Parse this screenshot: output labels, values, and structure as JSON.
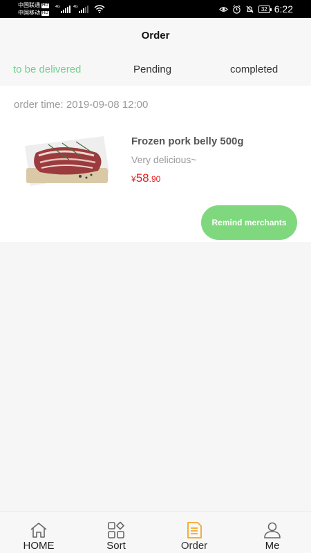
{
  "status_bar": {
    "carrier_1": "中国联通",
    "carrier_2": "中国移动",
    "hd_badge": "HD",
    "network_1": "4G",
    "network_2": "4G",
    "battery_level": "32",
    "time": "6:22"
  },
  "header": {
    "title": "Order"
  },
  "tabs": [
    {
      "label": "to be delivered",
      "active": true
    },
    {
      "label": "Pending",
      "active": false
    },
    {
      "label": "completed",
      "active": false
    }
  ],
  "order": {
    "order_time": "order time: 2019-09-08 12:00",
    "product_name": "Frozen pork belly 500g",
    "product_desc": "Very delicious~",
    "price_symbol": "¥",
    "price_integer": "58",
    "price_decimal": ".90",
    "remind_button": "Remind merchants"
  },
  "nav": [
    {
      "label": "HOME",
      "icon": "home-icon",
      "active": false
    },
    {
      "label": "Sort",
      "icon": "grid-icon",
      "active": false
    },
    {
      "label": "Order",
      "icon": "document-icon",
      "active": true
    },
    {
      "label": "Me",
      "icon": "person-icon",
      "active": false
    }
  ],
  "colors": {
    "accent": "#6fd18e",
    "button": "#7fd87e",
    "price": "#e02020",
    "nav_active": "#f5a623"
  }
}
